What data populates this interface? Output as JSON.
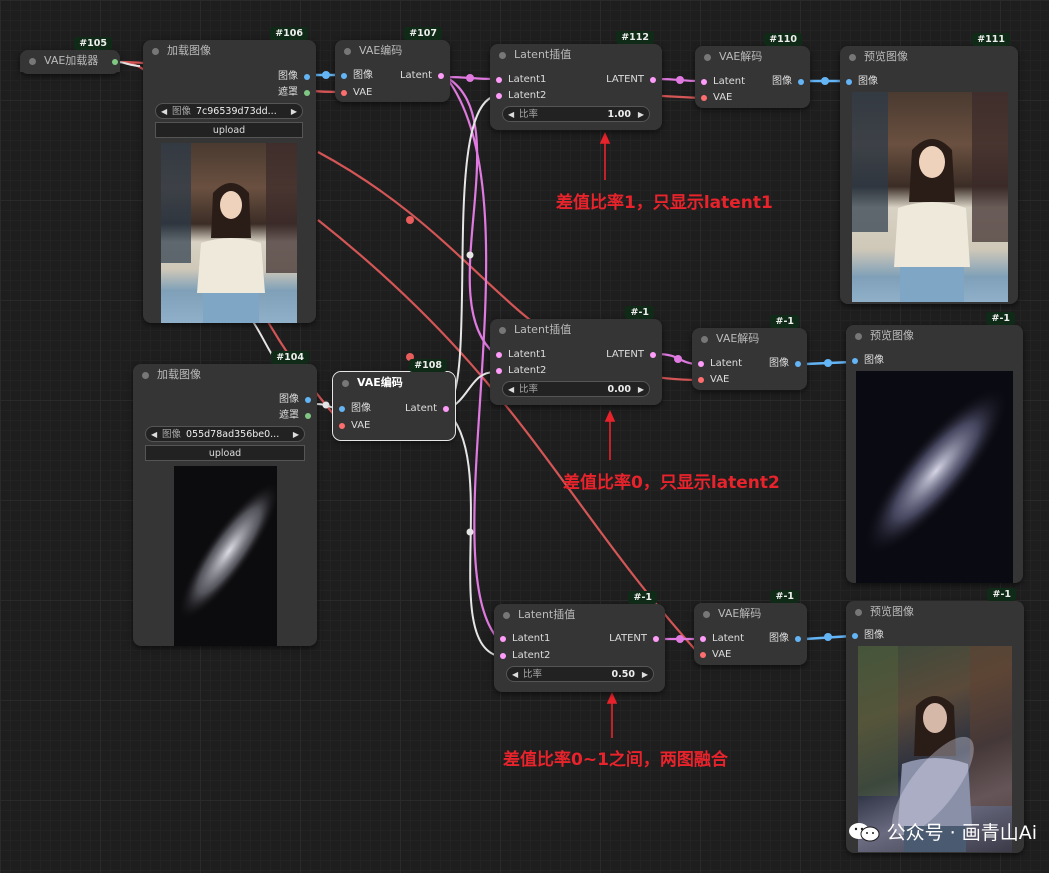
{
  "nodes": {
    "n105": {
      "id": "#105",
      "title": "VAE加载器"
    },
    "n106": {
      "id": "#106",
      "title": "加载图像",
      "out_image": "图像",
      "out_mask": "遮罩",
      "image_label": "图像",
      "image_value": "7c96539d73dd...",
      "upload": "upload"
    },
    "n107": {
      "id": "#107",
      "title": "VAE编码",
      "in_image": "图像",
      "in_vae": "VAE",
      "out_latent": "Latent"
    },
    "n112": {
      "id": "#112",
      "title": "Latent插值",
      "in_l1": "Latent1",
      "in_l2": "Latent2",
      "out": "LATENT",
      "ratio_label": "比率",
      "ratio_value": "1.00"
    },
    "n110": {
      "id": "#110",
      "title": "VAE解码",
      "in_latent": "Latent",
      "in_vae": "VAE",
      "out": "图像"
    },
    "n111": {
      "id": "#111",
      "title": "预览图像",
      "in_image": "图像"
    },
    "n104": {
      "id": "#104",
      "title": "加载图像",
      "out_image": "图像",
      "out_mask": "遮罩",
      "image_label": "图像",
      "image_value": "055d78ad356be0...",
      "upload": "upload"
    },
    "n108": {
      "id": "#108",
      "title": "VAE编码",
      "in_image": "图像",
      "in_vae": "VAE",
      "out_latent": "Latent"
    },
    "li2": {
      "id": "#-1",
      "title": "Latent插值",
      "in_l1": "Latent1",
      "in_l2": "Latent2",
      "out": "LATENT",
      "ratio_label": "比率",
      "ratio_value": "0.00"
    },
    "vd2": {
      "id": "#-1",
      "title": "VAE解码",
      "in_latent": "Latent",
      "in_vae": "VAE",
      "out": "图像"
    },
    "pv2": {
      "id": "#-1",
      "title": "预览图像",
      "in_image": "图像"
    },
    "li3": {
      "id": "#-1",
      "title": "Latent插值",
      "in_l1": "Latent1",
      "in_l2": "Latent2",
      "out": "LATENT",
      "ratio_label": "比率",
      "ratio_value": "0.50"
    },
    "vd3": {
      "id": "#-1",
      "title": "VAE解码",
      "in_latent": "Latent",
      "in_vae": "VAE",
      "out": "图像"
    },
    "pv3": {
      "id": "#-1",
      "title": "预览图像",
      "in_image": "图像"
    }
  },
  "annotations": {
    "a1": "差值比率1，只显示latent1",
    "a2": "差值比率0，只显示latent2",
    "a3": "差值比率0~1之间，两图融合"
  },
  "watermark": {
    "text": "公众号 · 画青山Ai",
    "icon": "wechat-icon"
  },
  "colors": {
    "image": "#64b5f6",
    "latent": "#ff9cf9",
    "vae": "#ff6e6e",
    "mask": "#81c784",
    "annotation": "#e8232b"
  }
}
